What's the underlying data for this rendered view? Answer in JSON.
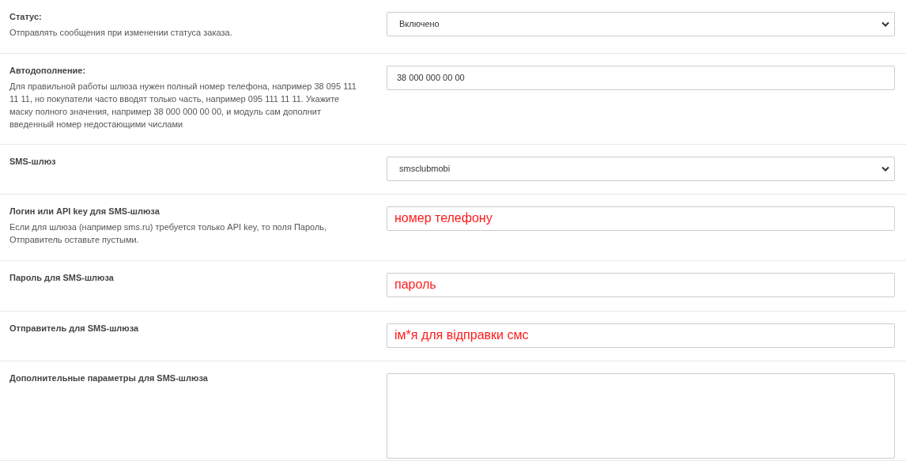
{
  "rows": [
    {
      "label": "Статус:",
      "description": "Отправлять сообщения при изменении статуса заказа.",
      "field": {
        "kind": "select",
        "value": "Включено"
      }
    },
    {
      "label": "Автодополнение:",
      "description": "Для правильной работы шлюза нужен полный номер телефона, например 38 095 111 11 11, но покупатели часто вводят только часть, например 095 111 11 11. Укажите маску полного значения, например 38 000 000 00 00, и модуль сам дополнит введенный номер недостающими числами",
      "field": {
        "kind": "input",
        "value": "38 000 000 00 00",
        "annotation": false
      }
    },
    {
      "label": "SMS-шлюз",
      "field": {
        "kind": "select",
        "value": "smsclubmobi"
      }
    },
    {
      "label": "Логин или API key для SMS-шлюза",
      "description": "Если для шлюза (например sms.ru) требуется только API key, то поля Пароль, Отправитель оставьте пустыми.",
      "field": {
        "kind": "input",
        "value": "номер телефону",
        "annotation": true
      }
    },
    {
      "label": "Пароль для SMS-шлюза",
      "field": {
        "kind": "input",
        "value": "пароль",
        "annotation": true
      }
    },
    {
      "label": "Отправитель для SMS-шлюза",
      "field": {
        "kind": "input",
        "value": "ім*я для відправки смс",
        "annotation": true
      }
    },
    {
      "label": "Дополнительные параметры для SMS-шлюза",
      "field": {
        "kind": "textarea"
      }
    }
  ]
}
